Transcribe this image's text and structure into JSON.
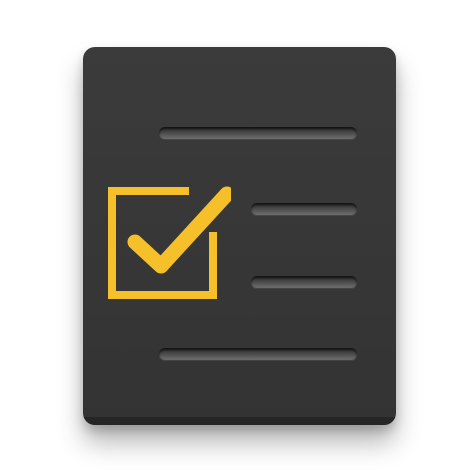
{
  "icon": {
    "name": "checklist-icon",
    "card_color": "#373737",
    "line_color": "#5a5a5a",
    "accent_color": "#f5c02a"
  },
  "items": [
    {
      "checked": false
    },
    {
      "checked": true
    },
    {
      "checked": false
    },
    {
      "checked": false
    }
  ]
}
